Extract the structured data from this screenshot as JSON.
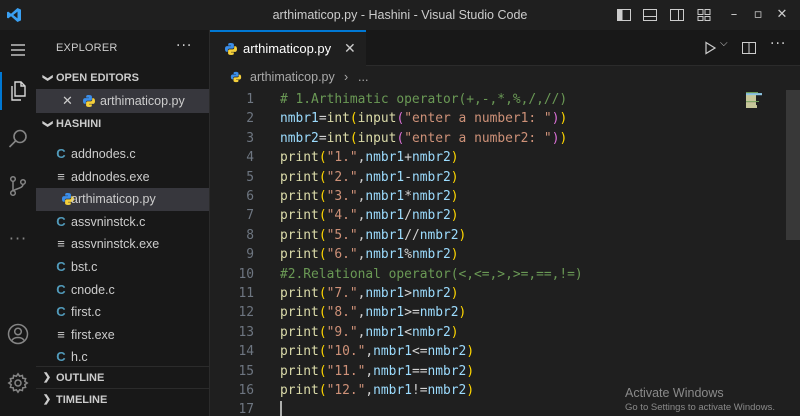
{
  "window": {
    "title": "arthimaticop.py - Hashini - Visual Studio Code",
    "controls": {
      "minimize": "–",
      "maximize": "▫",
      "close": "✕"
    }
  },
  "activity_bar": {
    "items": [
      "explorer-icon",
      "search-icon",
      "source-control-icon",
      "more-icon",
      "account-icon",
      "settings-gear-icon"
    ],
    "more_label": "···"
  },
  "sidebar": {
    "title": "EXPLORER",
    "more_label": "···",
    "open_editors": {
      "label": "OPEN EDITORS",
      "chevron": "❯",
      "close": "✕",
      "file": "arthimaticop.py"
    },
    "workspace": {
      "label": "HASHINI",
      "chevron": "❯",
      "files": [
        {
          "name": "addnodes.c",
          "type": "c",
          "glyph": "C"
        },
        {
          "name": "addnodes.exe",
          "type": "exe",
          "glyph": "≡"
        },
        {
          "name": "arthimaticop.py",
          "type": "py",
          "glyph": ""
        },
        {
          "name": "assvninstck.c",
          "type": "c",
          "glyph": "C"
        },
        {
          "name": "assvninstck.exe",
          "type": "exe",
          "glyph": "≡"
        },
        {
          "name": "bst.c",
          "type": "c",
          "glyph": "C"
        },
        {
          "name": "cnode.c",
          "type": "c",
          "glyph": "C"
        },
        {
          "name": "first.c",
          "type": "c",
          "glyph": "C"
        },
        {
          "name": "first.exe",
          "type": "exe",
          "glyph": "≡"
        },
        {
          "name": "h.c",
          "type": "c",
          "glyph": "C"
        }
      ]
    },
    "outline": {
      "label": "OUTLINE",
      "chevron": "❯"
    },
    "timeline": {
      "label": "TIMELINE",
      "chevron": "❯"
    }
  },
  "tabs": [
    {
      "label": "arthimaticop.py",
      "close": "✕",
      "active": true
    }
  ],
  "editor_actions": {
    "run_dropdown": "⌵",
    "more_label": "···"
  },
  "breadcrumb": {
    "file": "arthimaticop.py",
    "separator": "›",
    "more": "..."
  },
  "editor": {
    "lines": [
      {
        "n": "1",
        "tokens": [
          [
            "cm",
            "# 1.Arthimatic operator(+,-,*,%,/,//)"
          ]
        ]
      },
      {
        "n": "2",
        "tokens": [
          [
            "var",
            "nmbr1"
          ],
          [
            "op",
            "="
          ],
          [
            "fn",
            "int"
          ],
          [
            "p1",
            "("
          ],
          [
            "fn",
            "input"
          ],
          [
            "p2",
            "("
          ],
          [
            "str",
            "\"enter a number1: \""
          ],
          [
            "p2",
            ")"
          ],
          [
            "p1",
            ")"
          ]
        ]
      },
      {
        "n": "3",
        "tokens": [
          [
            "var",
            "nmbr2"
          ],
          [
            "op",
            "="
          ],
          [
            "fn",
            "int"
          ],
          [
            "p1",
            "("
          ],
          [
            "fn",
            "input"
          ],
          [
            "p2",
            "("
          ],
          [
            "str",
            "\"enter a number2: \""
          ],
          [
            "p2",
            ")"
          ],
          [
            "p1",
            ")"
          ]
        ]
      },
      {
        "n": "4",
        "tokens": [
          [
            "fn",
            "print"
          ],
          [
            "p1",
            "("
          ],
          [
            "str",
            "\"1.\""
          ],
          [
            "op",
            ","
          ],
          [
            "var",
            "nmbr1"
          ],
          [
            "op",
            "+"
          ],
          [
            "var",
            "nmbr2"
          ],
          [
            "p1",
            ")"
          ]
        ]
      },
      {
        "n": "5",
        "tokens": [
          [
            "fn",
            "print"
          ],
          [
            "p1",
            "("
          ],
          [
            "str",
            "\"2.\""
          ],
          [
            "op",
            ","
          ],
          [
            "var",
            "nmbr1"
          ],
          [
            "op",
            "-"
          ],
          [
            "var",
            "nmbr2"
          ],
          [
            "p1",
            ")"
          ]
        ]
      },
      {
        "n": "6",
        "tokens": [
          [
            "fn",
            "print"
          ],
          [
            "p1",
            "("
          ],
          [
            "str",
            "\"3.\""
          ],
          [
            "op",
            ","
          ],
          [
            "var",
            "nmbr1"
          ],
          [
            "op",
            "*"
          ],
          [
            "var",
            "nmbr2"
          ],
          [
            "p1",
            ")"
          ]
        ]
      },
      {
        "n": "7",
        "tokens": [
          [
            "fn",
            "print"
          ],
          [
            "p1",
            "("
          ],
          [
            "str",
            "\"4.\""
          ],
          [
            "op",
            ","
          ],
          [
            "var",
            "nmbr1"
          ],
          [
            "op",
            "/"
          ],
          [
            "var",
            "nmbr2"
          ],
          [
            "p1",
            ")"
          ]
        ]
      },
      {
        "n": "8",
        "tokens": [
          [
            "fn",
            "print"
          ],
          [
            "p1",
            "("
          ],
          [
            "str",
            "\"5.\""
          ],
          [
            "op",
            ","
          ],
          [
            "var",
            "nmbr1"
          ],
          [
            "op",
            "//"
          ],
          [
            "var",
            "nmbr2"
          ],
          [
            "p1",
            ")"
          ]
        ]
      },
      {
        "n": "9",
        "tokens": [
          [
            "fn",
            "print"
          ],
          [
            "p1",
            "("
          ],
          [
            "str",
            "\"6.\""
          ],
          [
            "op",
            ","
          ],
          [
            "var",
            "nmbr1"
          ],
          [
            "op",
            "%"
          ],
          [
            "var",
            "nmbr2"
          ],
          [
            "p1",
            ")"
          ]
        ]
      },
      {
        "n": "10",
        "tokens": [
          [
            "cm",
            "#2.Relational operator(<,<=,>,>=,==,!=)"
          ]
        ]
      },
      {
        "n": "11",
        "tokens": [
          [
            "fn",
            "print"
          ],
          [
            "p1",
            "("
          ],
          [
            "str",
            "\"7.\""
          ],
          [
            "op",
            ","
          ],
          [
            "var",
            "nmbr1"
          ],
          [
            "op",
            ">"
          ],
          [
            "var",
            "nmbr2"
          ],
          [
            "p1",
            ")"
          ]
        ]
      },
      {
        "n": "12",
        "tokens": [
          [
            "fn",
            "print"
          ],
          [
            "p1",
            "("
          ],
          [
            "str",
            "\"8.\""
          ],
          [
            "op",
            ","
          ],
          [
            "var",
            "nmbr1"
          ],
          [
            "op",
            ">="
          ],
          [
            "var",
            "nmbr2"
          ],
          [
            "p1",
            ")"
          ]
        ]
      },
      {
        "n": "13",
        "tokens": [
          [
            "fn",
            "print"
          ],
          [
            "p1",
            "("
          ],
          [
            "str",
            "\"9.\""
          ],
          [
            "op",
            ","
          ],
          [
            "var",
            "nmbr1"
          ],
          [
            "op",
            "<"
          ],
          [
            "var",
            "nmbr2"
          ],
          [
            "p1",
            ")"
          ]
        ]
      },
      {
        "n": "14",
        "tokens": [
          [
            "fn",
            "print"
          ],
          [
            "p1",
            "("
          ],
          [
            "str",
            "\"10.\""
          ],
          [
            "op",
            ","
          ],
          [
            "var",
            "nmbr1"
          ],
          [
            "op",
            "<="
          ],
          [
            "var",
            "nmbr2"
          ],
          [
            "p1",
            ")"
          ]
        ]
      },
      {
        "n": "15",
        "tokens": [
          [
            "fn",
            "print"
          ],
          [
            "p1",
            "("
          ],
          [
            "str",
            "\"11.\""
          ],
          [
            "op",
            ","
          ],
          [
            "var",
            "nmbr1"
          ],
          [
            "op",
            "=="
          ],
          [
            "var",
            "nmbr2"
          ],
          [
            "p1",
            ")"
          ]
        ]
      },
      {
        "n": "16",
        "tokens": [
          [
            "fn",
            "print"
          ],
          [
            "p1",
            "("
          ],
          [
            "str",
            "\"12.\""
          ],
          [
            "op",
            ","
          ],
          [
            "var",
            "nmbr1"
          ],
          [
            "op",
            "!="
          ],
          [
            "var",
            "nmbr2"
          ],
          [
            "p1",
            ")"
          ]
        ]
      },
      {
        "n": "17",
        "tokens": []
      }
    ]
  },
  "watermark": {
    "title": "Activate Windows",
    "subtitle": "Go to Settings to activate Windows."
  },
  "colors": {
    "accent": "#0078d4",
    "editor_bg": "#1f1f1f",
    "sidebar_bg": "#181818"
  }
}
